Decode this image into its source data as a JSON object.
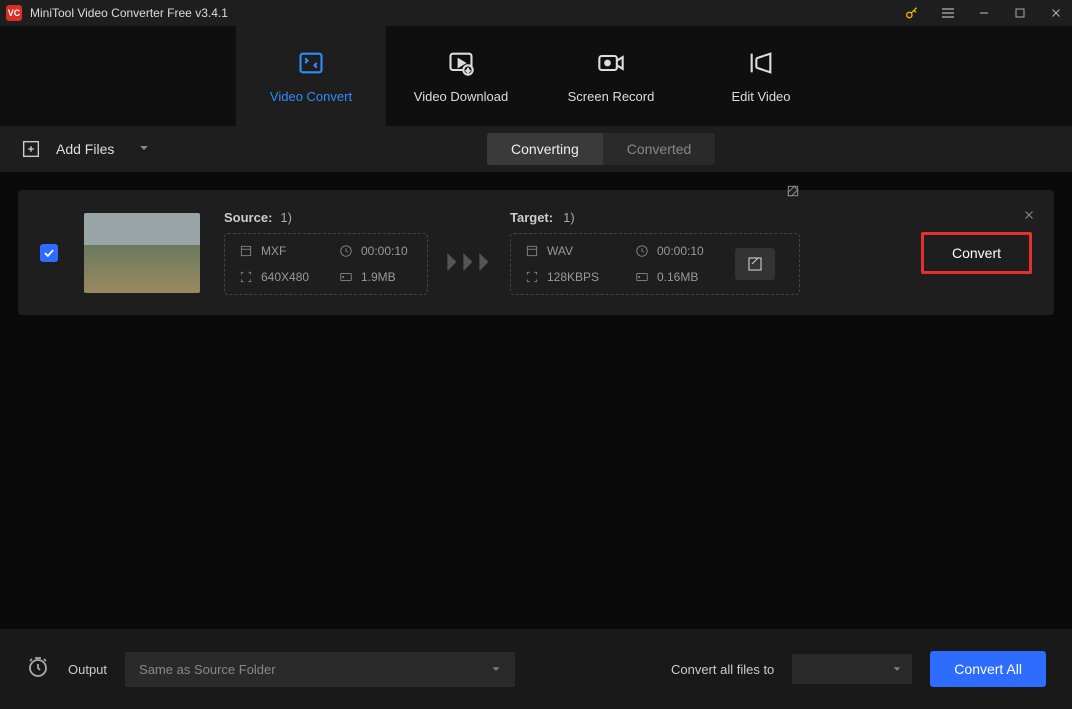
{
  "titlebar": {
    "title": "MiniTool Video Converter Free v3.4.1"
  },
  "nav": {
    "tabs": [
      {
        "label": "Video Convert"
      },
      {
        "label": "Video Download"
      },
      {
        "label": "Screen Record"
      },
      {
        "label": "Edit Video"
      }
    ]
  },
  "toolbar": {
    "add_files": "Add Files",
    "seg": {
      "converting": "Converting",
      "converted": "Converted"
    }
  },
  "file": {
    "source": {
      "label": "Source:",
      "count": "1)",
      "format": "MXF",
      "duration": "00:00:10",
      "resolution": "640X480",
      "size": "1.9MB"
    },
    "target": {
      "label": "Target:",
      "count": "1)",
      "format": "WAV",
      "duration": "00:00:10",
      "bitrate": "128KBPS",
      "size": "0.16MB"
    },
    "convert_btn": "Convert"
  },
  "footer": {
    "output_label": "Output",
    "output_value": "Same as Source Folder",
    "convert_all_label": "Convert all files to",
    "convert_all_btn": "Convert All"
  }
}
